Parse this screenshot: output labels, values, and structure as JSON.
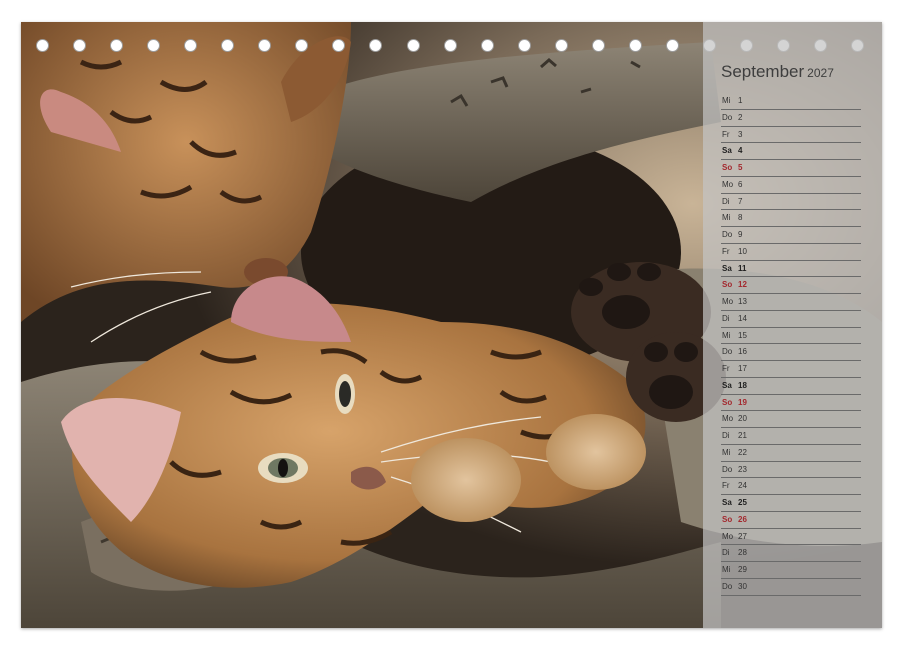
{
  "calendar": {
    "month": "September",
    "year": "2027",
    "days": [
      {
        "dn": "Mi",
        "d": "1",
        "type": "weekday"
      },
      {
        "dn": "Do",
        "d": "2",
        "type": "weekday"
      },
      {
        "dn": "Fr",
        "d": "3",
        "type": "weekday"
      },
      {
        "dn": "Sa",
        "d": "4",
        "type": "saturday"
      },
      {
        "dn": "So",
        "d": "5",
        "type": "sunday"
      },
      {
        "dn": "Mo",
        "d": "6",
        "type": "weekday"
      },
      {
        "dn": "Di",
        "d": "7",
        "type": "weekday"
      },
      {
        "dn": "Mi",
        "d": "8",
        "type": "weekday"
      },
      {
        "dn": "Do",
        "d": "9",
        "type": "weekday"
      },
      {
        "dn": "Fr",
        "d": "10",
        "type": "weekday"
      },
      {
        "dn": "Sa",
        "d": "11",
        "type": "saturday"
      },
      {
        "dn": "So",
        "d": "12",
        "type": "sunday"
      },
      {
        "dn": "Mo",
        "d": "13",
        "type": "weekday"
      },
      {
        "dn": "Di",
        "d": "14",
        "type": "weekday"
      },
      {
        "dn": "Mi",
        "d": "15",
        "type": "weekday"
      },
      {
        "dn": "Do",
        "d": "16",
        "type": "weekday"
      },
      {
        "dn": "Fr",
        "d": "17",
        "type": "weekday"
      },
      {
        "dn": "Sa",
        "d": "18",
        "type": "saturday"
      },
      {
        "dn": "So",
        "d": "19",
        "type": "sunday"
      },
      {
        "dn": "Mo",
        "d": "20",
        "type": "weekday"
      },
      {
        "dn": "Di",
        "d": "21",
        "type": "weekday"
      },
      {
        "dn": "Mi",
        "d": "22",
        "type": "weekday"
      },
      {
        "dn": "Do",
        "d": "23",
        "type": "weekday"
      },
      {
        "dn": "Fr",
        "d": "24",
        "type": "weekday"
      },
      {
        "dn": "Sa",
        "d": "25",
        "type": "saturday"
      },
      {
        "dn": "So",
        "d": "26",
        "type": "sunday"
      },
      {
        "dn": "Mo",
        "d": "27",
        "type": "weekday"
      },
      {
        "dn": "Di",
        "d": "28",
        "type": "weekday"
      },
      {
        "dn": "Mi",
        "d": "29",
        "type": "weekday"
      },
      {
        "dn": "Do",
        "d": "30",
        "type": "weekday"
      }
    ]
  },
  "photo": {
    "subject": "bengal-kittens-photo",
    "colors": {
      "fur": "#b8814a",
      "bark": "#6b6358",
      "shadow": "#2a221b",
      "sunday_text": "#a3282e"
    }
  },
  "binding": {
    "ring_count": 23
  }
}
